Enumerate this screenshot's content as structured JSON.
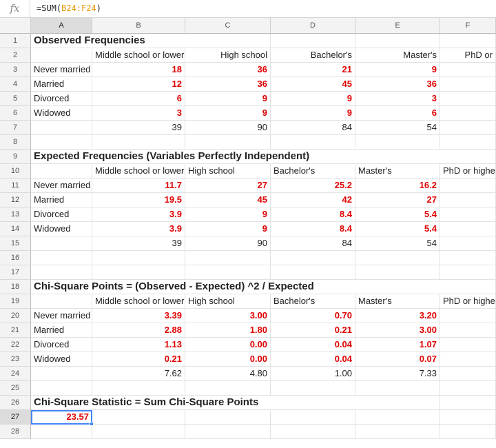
{
  "formula_bar": {
    "icon": "fx-icon",
    "prefix": "=SUM(",
    "range": "B24:F24",
    "suffix": ")"
  },
  "columns": [
    "A",
    "B",
    "C",
    "D",
    "E",
    "F"
  ],
  "row_numbers": [
    "1",
    "2",
    "3",
    "4",
    "5",
    "6",
    "7",
    "8",
    "9",
    "10",
    "11",
    "12",
    "13",
    "14",
    "15",
    "16",
    "17",
    "18",
    "19",
    "20",
    "21",
    "22",
    "23",
    "24",
    "25",
    "26",
    "27",
    "28"
  ],
  "selected_cell": "A27",
  "sheet": {
    "r1": {
      "A": "Observed Frequencies"
    },
    "r2": {
      "B": "Middle school or lower",
      "C": "High school",
      "D": "Bachelor's",
      "E": "Master's",
      "F": "PhD or"
    },
    "r3": {
      "A": "Never married",
      "B": "18",
      "C": "36",
      "D": "21",
      "E": "9"
    },
    "r4": {
      "A": "Married",
      "B": "12",
      "C": "36",
      "D": "45",
      "E": "36"
    },
    "r5": {
      "A": "Divorced",
      "B": "6",
      "C": "9",
      "D": "9",
      "E": "3"
    },
    "r6": {
      "A": "Widowed",
      "B": "3",
      "C": "9",
      "D": "9",
      "E": "6"
    },
    "r7": {
      "B": "39",
      "C": "90",
      "D": "84",
      "E": "54"
    },
    "r9": {
      "A": "Expected Frequencies (Variables Perfectly Independent)"
    },
    "r10": {
      "B": "Middle school or lower",
      "C": "High school",
      "D": "Bachelor's",
      "E": "Master's",
      "F": "PhD or higher"
    },
    "r11": {
      "A": "Never married",
      "B": "11.7",
      "C": "27",
      "D": "25.2",
      "E": "16.2"
    },
    "r12": {
      "A": "Married",
      "B": "19.5",
      "C": "45",
      "D": "42",
      "E": "27"
    },
    "r13": {
      "A": "Divorced",
      "B": "3.9",
      "C": "9",
      "D": "8.4",
      "E": "5.4"
    },
    "r14": {
      "A": "Widowed",
      "B": "3.9",
      "C": "9",
      "D": "8.4",
      "E": "5.4"
    },
    "r15": {
      "B": "39",
      "C": "90",
      "D": "84",
      "E": "54"
    },
    "r18": {
      "A": "Chi-Square Points = (Observed - Expected) ^2 / Expected"
    },
    "r19": {
      "B": "Middle school or lower",
      "C": "High school",
      "D": "Bachelor's",
      "E": "Master's",
      "F": "PhD or higher"
    },
    "r20": {
      "A": "Never married",
      "B": "3.39",
      "C": "3.00",
      "D": "0.70",
      "E": "3.20"
    },
    "r21": {
      "A": "Married",
      "B": "2.88",
      "C": "1.80",
      "D": "0.21",
      "E": "3.00"
    },
    "r22": {
      "A": "Divorced",
      "B": "1.13",
      "C": "0.00",
      "D": "0.04",
      "E": "1.07"
    },
    "r23": {
      "A": "Widowed",
      "B": "0.21",
      "C": "0.00",
      "D": "0.04",
      "E": "0.07"
    },
    "r24": {
      "B": "7.62",
      "C": "4.80",
      "D": "1.00",
      "E": "7.33"
    },
    "r26": {
      "A": "Chi-Square Statistic = Sum Chi-Square Points"
    },
    "r27": {
      "A": "23.57"
    }
  },
  "colors": {
    "highlight_red": "#e00000",
    "formula_ref": "#e69500",
    "selection": "#4285f4"
  }
}
